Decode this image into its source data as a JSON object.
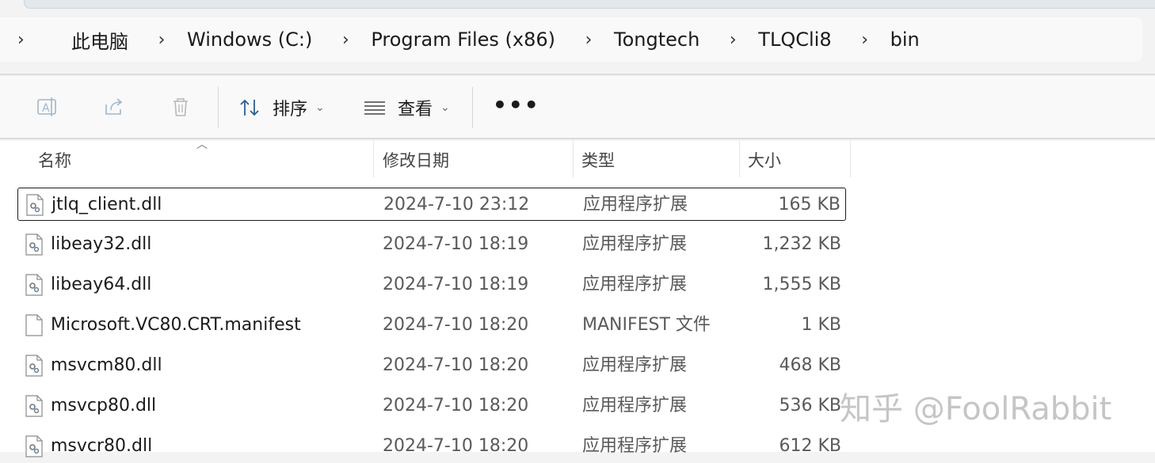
{
  "breadcrumb": {
    "items": [
      "此电脑",
      "Windows (C:)",
      "Program Files (x86)",
      "Tongtech",
      "TLQCli8",
      "bin"
    ]
  },
  "command_bar": {
    "sort_label": "排序",
    "view_label": "查看",
    "more_label": "•••"
  },
  "columns": {
    "name": "名称",
    "date": "修改日期",
    "type": "类型",
    "size": "大小"
  },
  "files": [
    {
      "name": "jtlq_client.dll",
      "date": "2024-7-10 23:12",
      "type": "应用程序扩展",
      "size": "165 KB",
      "icon": "dll-file-icon",
      "selected": true
    },
    {
      "name": "libeay32.dll",
      "date": "2024-7-10 18:19",
      "type": "应用程序扩展",
      "size": "1,232 KB",
      "icon": "dll-file-icon"
    },
    {
      "name": "libeay64.dll",
      "date": "2024-7-10 18:19",
      "type": "应用程序扩展",
      "size": "1,555 KB",
      "icon": "dll-file-icon"
    },
    {
      "name": "Microsoft.VC80.CRT.manifest",
      "date": "2024-7-10 18:20",
      "type": "MANIFEST 文件",
      "size": "1 KB",
      "icon": "blank-file-icon"
    },
    {
      "name": "msvcm80.dll",
      "date": "2024-7-10 18:20",
      "type": "应用程序扩展",
      "size": "468 KB",
      "icon": "dll-file-icon"
    },
    {
      "name": "msvcp80.dll",
      "date": "2024-7-10 18:20",
      "type": "应用程序扩展",
      "size": "536 KB",
      "icon": "dll-file-icon"
    },
    {
      "name": "msvcr80.dll",
      "date": "2024-7-10 18:20",
      "type": "应用程序扩展",
      "size": "612 KB",
      "icon": "dll-file-icon"
    }
  ],
  "watermark": "知乎 @FoolRabbit"
}
